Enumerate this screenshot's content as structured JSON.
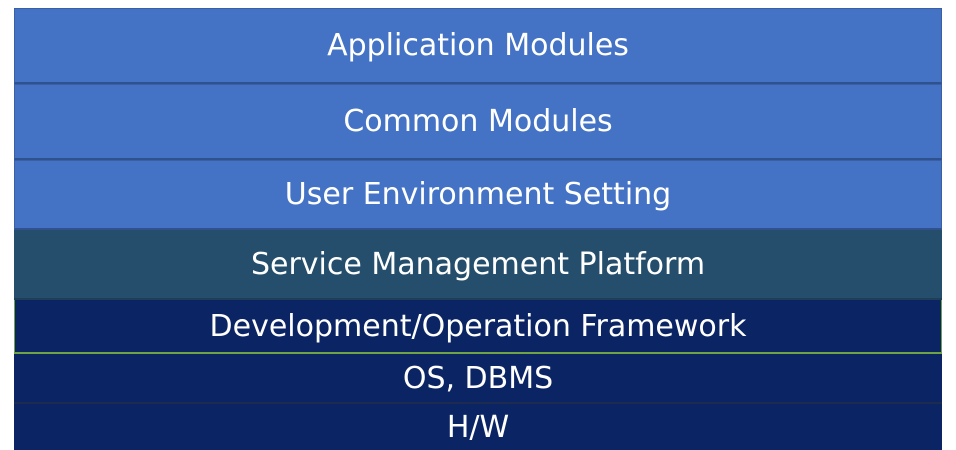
{
  "layers": [
    {
      "label": "Application Modules",
      "color": "#4472c4"
    },
    {
      "label": "Common Modules",
      "color": "#4472c4"
    },
    {
      "label": "User Environment Setting",
      "color": "#4472c4"
    },
    {
      "label": "Service Management Platform",
      "color": "#244e6b"
    },
    {
      "label": "Development/Operation Framework",
      "color": "#0b2463"
    },
    {
      "label": "OS, DBMS",
      "color": "#0b2463"
    },
    {
      "label": "H/W",
      "color": "#0b2463"
    }
  ]
}
